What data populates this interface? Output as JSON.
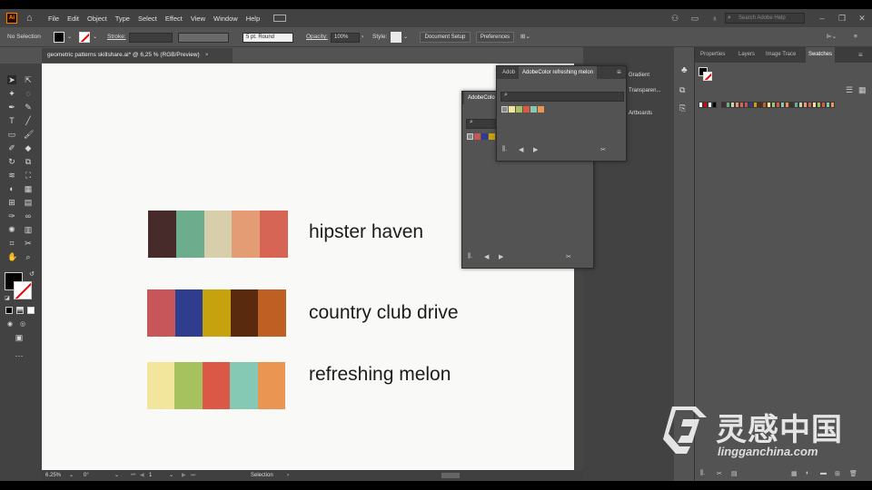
{
  "menubar": {
    "logo": "Ai",
    "items": [
      "File",
      "Edit",
      "Object",
      "Type",
      "Select",
      "Effect",
      "View",
      "Window",
      "Help"
    ],
    "search_placeholder": "Search Adobe Help"
  },
  "control_bar": {
    "selection": "No Selection",
    "stroke_label": "Stroke:",
    "brush": "5 pt. Round",
    "opacity_label": "Opacity:",
    "opacity_value": "100%",
    "style_label": "Style:",
    "document_setup": "Document Setup",
    "preferences": "Preferences"
  },
  "document_tab": {
    "title": "geometric patterns skillshare.ai* @ 6,25 % (RGB/Preview)",
    "close": "×"
  },
  "artboard": {
    "palettes": [
      {
        "label": "hipster haven",
        "colors": [
          "#472b2a",
          "#6dac8d",
          "#d7cfac",
          "#e39c74",
          "#d76556"
        ]
      },
      {
        "label": "country club drive",
        "colors": [
          "#c65659",
          "#2e3d8e",
          "#c7a20f",
          "#5a2a0e",
          "#be6024"
        ]
      },
      {
        "label": "refreshing melon",
        "colors": [
          "#f1e69c",
          "#a5c25f",
          "#dc5846",
          "#85c9b5",
          "#eb9553"
        ]
      }
    ],
    "tiny_labels": [
      "·····",
      "·····",
      "·····",
      "·····",
      "·····"
    ]
  },
  "status_bar": {
    "zoom": "6.25%",
    "angle": "0°",
    "artboard": "1",
    "tool": "Selection"
  },
  "panel_back": {
    "tab": "AdobeColo"
  },
  "panel_front": {
    "tab_partial": "Adob",
    "tab_active": "AdobeColor  refreshing melon"
  },
  "dock": {
    "items": [
      "Gradient",
      "Transparen...",
      "Artboards"
    ]
  },
  "right_panel": {
    "tabs": [
      "Properties",
      "Layers",
      "Image Trace",
      "Swatches"
    ]
  },
  "watermark": {
    "cn": "灵感中国",
    "en": "lingganchina.com"
  },
  "colors": {
    "menubar": "#424242",
    "panel": "#535353",
    "artboard": "#f9f9f7"
  }
}
